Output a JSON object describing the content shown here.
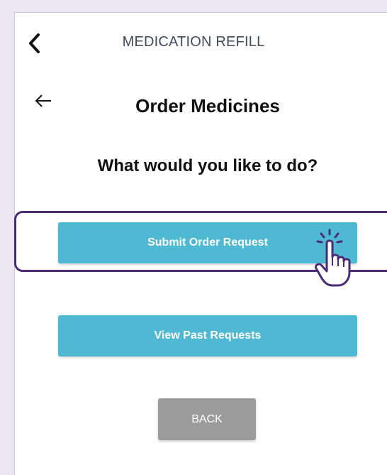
{
  "header": {
    "title": "MEDICATION REFILL",
    "back_icon": "chevron-left-icon"
  },
  "page": {
    "back_icon": "arrow-left-icon",
    "title": "Order Medicines",
    "question": "What would you like to do?"
  },
  "actions": {
    "submit_label": "Submit Order Request",
    "view_label": "View Past Requests",
    "back_label": "BACK"
  },
  "overlay": {
    "pointer_icon": "hand-pointer-click-icon",
    "highlight_color": "#4a2c76"
  },
  "colors": {
    "primary_button": "#4fb8d2",
    "back_button": "#9b9b9b",
    "frame_background": "#ebe6f1"
  }
}
